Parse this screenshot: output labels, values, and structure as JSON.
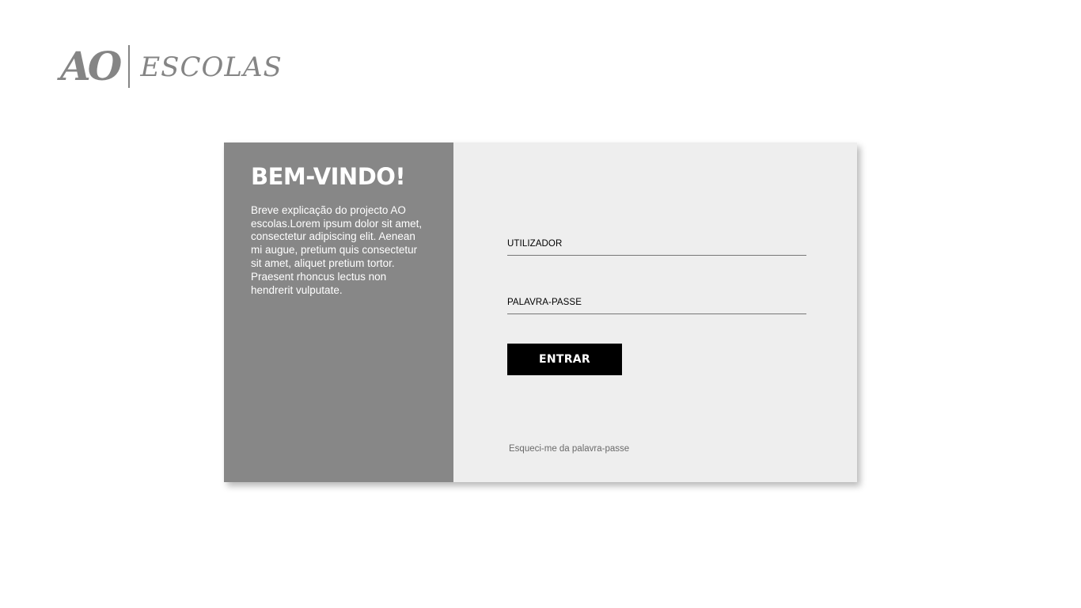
{
  "logo": {
    "mark": "AO",
    "word": "ESCOLAS"
  },
  "intro": {
    "title": "BEM-VINDO!",
    "text": "Breve explicação do projecto AO escolas.Lorem ipsum dolor sit amet, consectetur adipiscing elit. Aenean mi augue, pretium quis consectetur sit amet, aliquet pretium tortor. Praesent rhoncus lectus non hendrerit vulputate."
  },
  "login": {
    "username_label": "UTILIZADOR",
    "username_value": "",
    "password_label": "PALAVRA-PASSE",
    "password_value": "",
    "submit_label": "ENTRAR",
    "forgot_label": "Esqueci-me da palavra-passe"
  },
  "colors": {
    "intro_panel": "#878787",
    "login_panel": "#eeeeee",
    "button": "#000000",
    "logo": "#858585"
  }
}
